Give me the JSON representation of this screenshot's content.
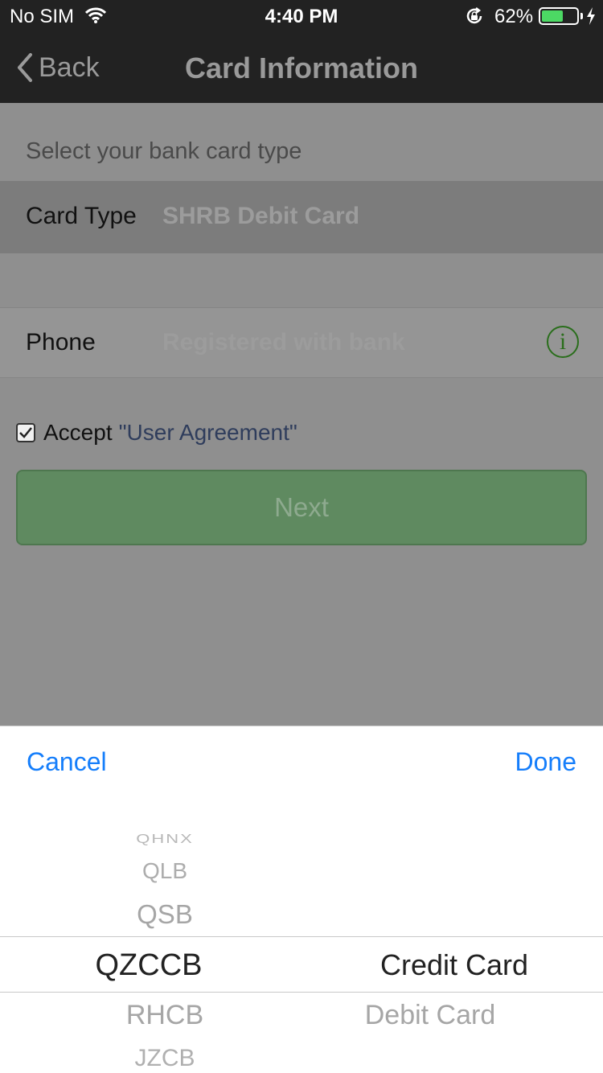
{
  "status_bar": {
    "carrier": "No SIM",
    "time": "4:40 PM",
    "battery_percent": "62%",
    "battery_level": 0.62
  },
  "nav": {
    "back_label": "Back",
    "title": "Card Information"
  },
  "form": {
    "section_header": "Select your bank card type",
    "card_type_label": "Card Type",
    "card_type_value": "SHRB Debit Card",
    "phone_label": "Phone",
    "phone_placeholder": "Registered with bank",
    "accept_label": "Accept",
    "agreement_link": "\"User Agreement\"",
    "accept_checked": true,
    "next_label": "Next"
  },
  "picker": {
    "cancel_label": "Cancel",
    "done_label": "Done",
    "banks": [
      "QHNX",
      "QLB",
      "QSB",
      "QZCCB",
      "RHCB",
      "JZCB"
    ],
    "selected_bank": "QZCCB",
    "card_types": [
      "Credit Card",
      "Debit Card"
    ],
    "selected_card_type": "Credit Card"
  },
  "colors": {
    "accent": "#157efb",
    "nav_background": "#222222",
    "overlay": "#8f8f8f",
    "button_green": "#5f8a60",
    "info_icon": "#2a6e1c"
  }
}
